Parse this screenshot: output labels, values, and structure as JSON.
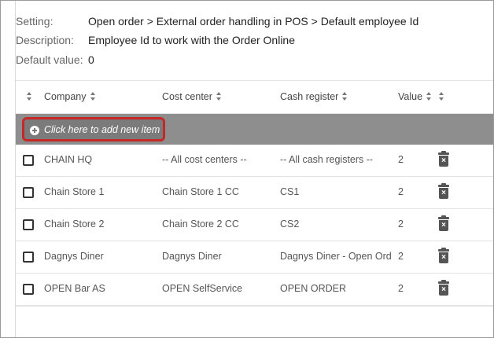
{
  "info": {
    "setting_label": "Setting:",
    "setting_value": "Open order > External order handling in POS > Default employee Id",
    "description_label": "Description:",
    "description_value": "Employee Id to work with the Order Online",
    "default_label": "Default value:",
    "default_value": "0"
  },
  "table": {
    "columns": {
      "company": "Company",
      "cost_center": "Cost center",
      "cash_register": "Cash register",
      "value": "Value"
    },
    "add_item_label": "Click here to add new item",
    "rows": [
      {
        "company": "CHAIN HQ",
        "cost_center": "-- All cost centers --",
        "cash_register": "-- All cash registers --",
        "value": "2"
      },
      {
        "company": "Chain Store 1",
        "cost_center": "Chain Store 1 CC",
        "cash_register": "CS1",
        "value": "2"
      },
      {
        "company": "Chain Store 2",
        "cost_center": "Chain Store 2 CC",
        "cash_register": "CS2",
        "value": "2"
      },
      {
        "company": "Dagnys Diner",
        "cost_center": "Dagnys Diner",
        "cash_register": "Dagnys Diner - Open Orde",
        "value": "2"
      },
      {
        "company": "OPEN Bar AS",
        "cost_center": "OPEN SelfService",
        "cash_register": "OPEN ORDER",
        "value": "2"
      }
    ]
  },
  "colors": {
    "add_bar": "#8e8e8e",
    "highlight_border": "#c62828"
  }
}
